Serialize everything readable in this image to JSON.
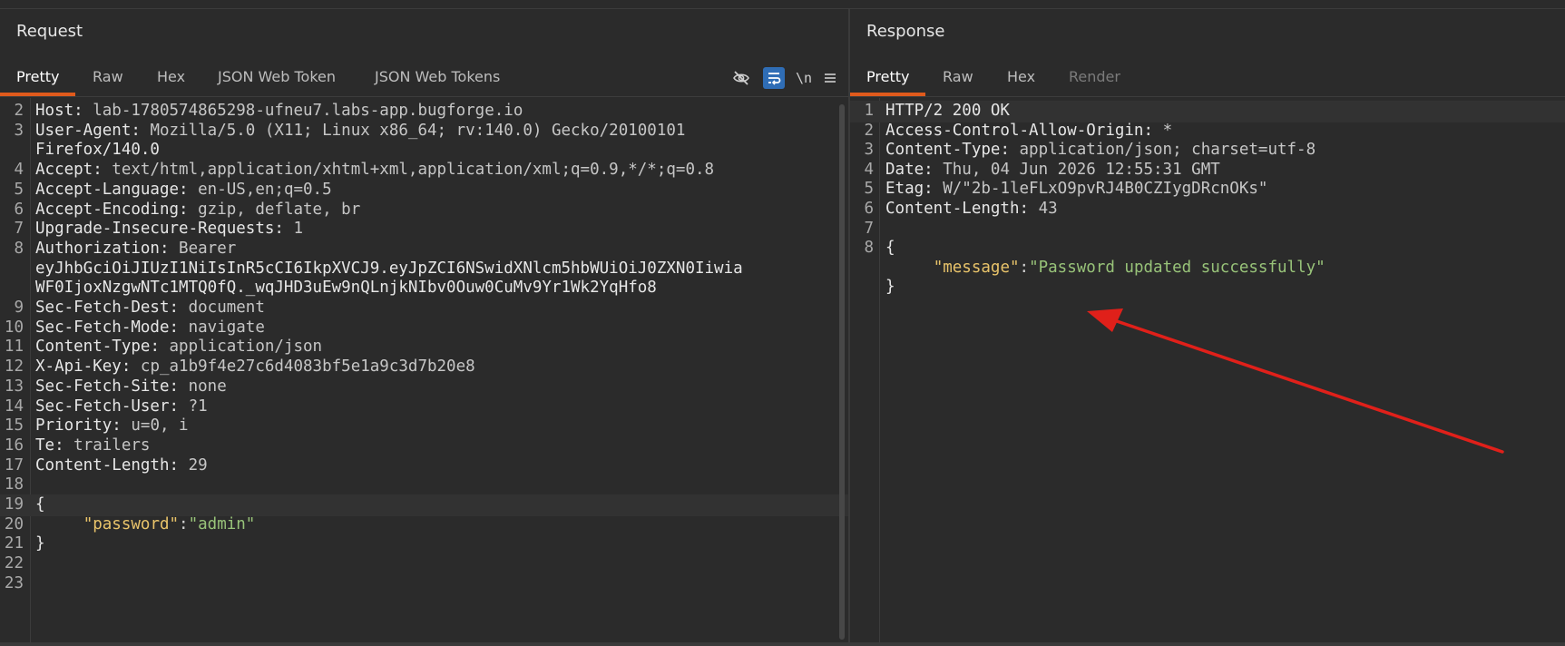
{
  "request": {
    "title": "Request",
    "tabs": [
      {
        "label": "Pretty",
        "active": true
      },
      {
        "label": "Raw"
      },
      {
        "label": "Hex"
      },
      {
        "label": "JSON Web Token"
      },
      {
        "label": "JSON Web Tokens"
      }
    ],
    "tools": [
      "eye-slash-icon",
      "wrap-lines-icon",
      "newline-icon",
      "menu-icon"
    ],
    "newline_label": "\\n",
    "lines": [
      {
        "n": "2",
        "name": "Host",
        "value": "lab-1780574865298-ufneu7.labs-app.bugforge.io"
      },
      {
        "n": "3",
        "name": "User-Agent",
        "value": "Mozilla/5.0 (X11; Linux x86_64; rv:140.0) Gecko/20100101"
      },
      {
        "n": "",
        "cont": "Firefox/140.0"
      },
      {
        "n": "4",
        "name": "Accept",
        "value": "text/html,application/xhtml+xml,application/xml;q=0.9,*/*;q=0.8"
      },
      {
        "n": "5",
        "name": "Accept-Language",
        "value": "en-US,en;q=0.5"
      },
      {
        "n": "6",
        "name": "Accept-Encoding",
        "value": "gzip, deflate, br"
      },
      {
        "n": "7",
        "name": "Upgrade-Insecure-Requests",
        "value": "1"
      },
      {
        "n": "8",
        "name": "Authorization",
        "value": "Bearer"
      },
      {
        "n": "",
        "cont": "eyJhbGciOiJIUzI1NiIsInR5cCI6IkpXVCJ9.eyJpZCI6NSwidXNlcm5hbWUiOiJ0ZXN0Iiwia"
      },
      {
        "n": "",
        "cont": "WF0IjoxNzgwNTc1MTQ0fQ._wqJHD3uEw9nQLnjkNIbv0Ouw0CuMv9Yr1Wk2YqHfo8"
      },
      {
        "n": "9",
        "name": "Sec-Fetch-Dest",
        "value": "document"
      },
      {
        "n": "10",
        "name": "Sec-Fetch-Mode",
        "value": "navigate"
      },
      {
        "n": "11",
        "name": "Content-Type",
        "value": "application/json"
      },
      {
        "n": "12",
        "name": "X-Api-Key",
        "value": "cp_a1b9f4e27c6d4083bf5e1a9c3d7b20e8"
      },
      {
        "n": "13",
        "name": "Sec-Fetch-Site",
        "value": "none"
      },
      {
        "n": "14",
        "name": "Sec-Fetch-User",
        "value": "?1"
      },
      {
        "n": "15",
        "name": "Priority",
        "value": "u=0, i"
      },
      {
        "n": "16",
        "name": "Te",
        "value": "trailers"
      },
      {
        "n": "17",
        "name": "Content-Length",
        "value": "29"
      },
      {
        "n": "18",
        "cont": ""
      },
      {
        "n": "19",
        "cont": "{",
        "highlight": true
      },
      {
        "n": "20",
        "json_key": "\"password\"",
        "json_val": "\"admin\""
      },
      {
        "n": "21",
        "cont": "}"
      },
      {
        "n": "22",
        "cont": ""
      },
      {
        "n": "23",
        "cont": ""
      }
    ]
  },
  "response": {
    "title": "Response",
    "tabs": [
      {
        "label": "Pretty",
        "active": true
      },
      {
        "label": "Raw"
      },
      {
        "label": "Hex"
      },
      {
        "label": "Render",
        "disabled": true
      }
    ],
    "lines": [
      {
        "n": "1",
        "cont": "HTTP/2 200 OK",
        "highlight": true
      },
      {
        "n": "2",
        "name": "Access-Control-Allow-Origin",
        "value": "*"
      },
      {
        "n": "3",
        "name": "Content-Type",
        "value": "application/json; charset=utf-8"
      },
      {
        "n": "4",
        "name": "Date",
        "value": "Thu, 04 Jun 2026 12:55:31 GMT"
      },
      {
        "n": "5",
        "name": "Etag",
        "value": "W/\"2b-1leFLxO9pvRJ4B0CZIygDRcnOKs\""
      },
      {
        "n": "6",
        "name": "Content-Length",
        "value": "43"
      },
      {
        "n": "7",
        "cont": ""
      },
      {
        "n": "8",
        "cont": "{"
      },
      {
        "n": "",
        "json_key": "\"message\"",
        "json_val": "\"Password updated successfully\""
      },
      {
        "n": "",
        "cont": "}"
      }
    ]
  },
  "colors": {
    "background": "#2b2b2b",
    "accent_tab": "#e05a1c",
    "json_key": "#e8c36a",
    "json_string": "#98c379",
    "annotation_arrow": "#e0201a"
  }
}
